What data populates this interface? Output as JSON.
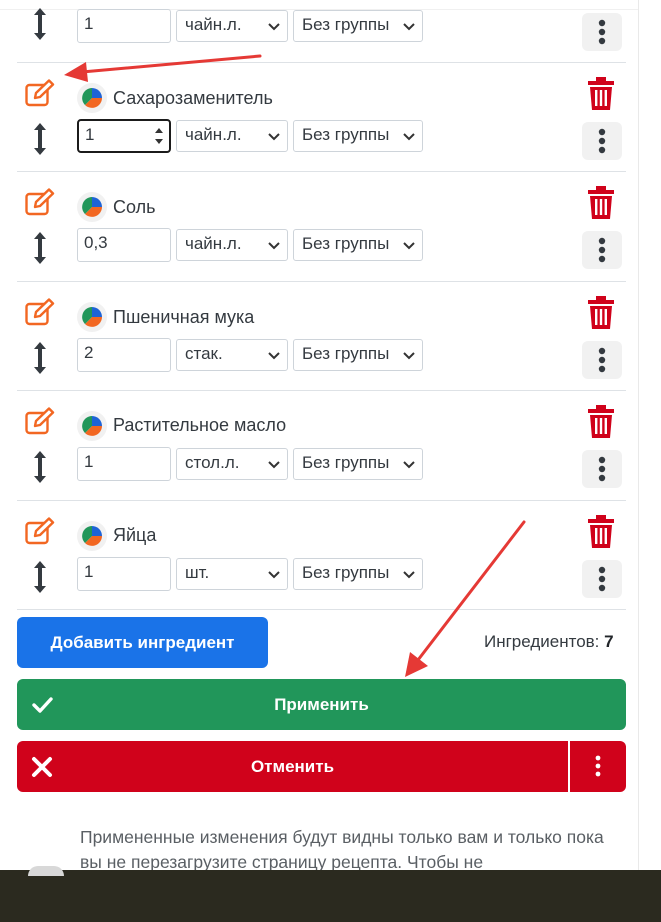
{
  "ingredients": [
    {
      "name": "",
      "quantity": "1",
      "unit": "чайн.л.",
      "group": "Без группы"
    },
    {
      "name": "Сахарозаменитель",
      "quantity": "1",
      "unit": "чайн.л.",
      "group": "Без группы"
    },
    {
      "name": "Соль",
      "quantity": "0,3",
      "unit": "чайн.л.",
      "group": "Без группы"
    },
    {
      "name": "Пшеничная мука",
      "quantity": "2",
      "unit": "стак.",
      "group": "Без группы"
    },
    {
      "name": "Растительное масло",
      "quantity": "1",
      "unit": "стол.л.",
      "group": "Без группы"
    },
    {
      "name": "Яйца",
      "quantity": "1",
      "unit": "шт.",
      "group": "Без группы"
    }
  ],
  "actions": {
    "add_label": "Добавить ингредиент",
    "count_label": "Ингредиентов:",
    "count_value": "7",
    "apply_label": "Применить",
    "cancel_label": "Отменить"
  },
  "note": "Примененные изменения будут видны только вам и только пока вы не перезагрузите страницу рецепта. Чтобы не",
  "colors": {
    "edit": "#f26722",
    "trash": "#d0021b",
    "add": "#1a73e8",
    "apply": "#21965a",
    "cancel": "#d0021b",
    "arrow": "#e53935"
  }
}
